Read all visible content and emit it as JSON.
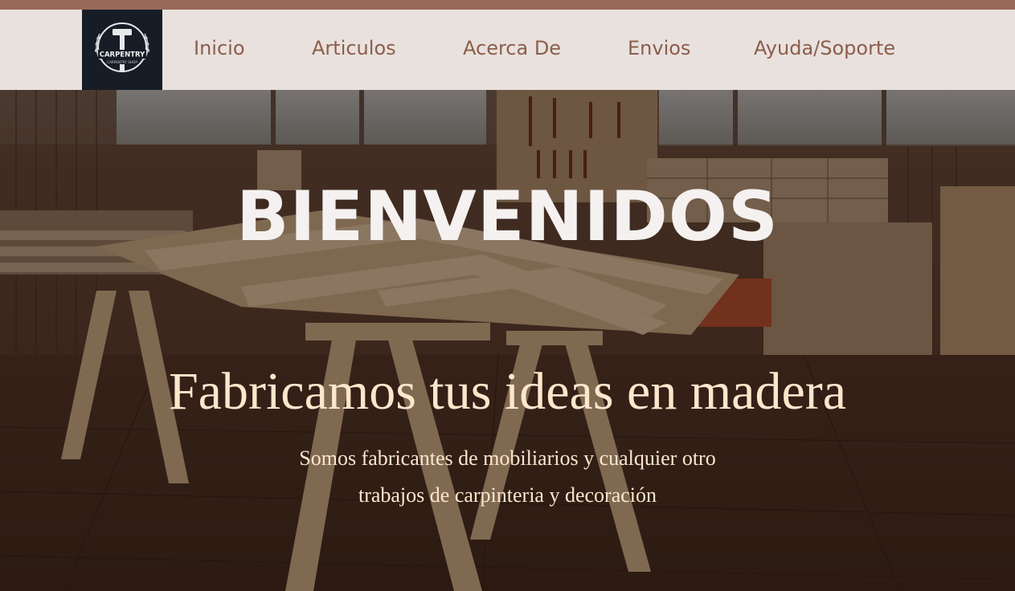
{
  "brand": {
    "logo_text": "CARPENTRY",
    "logo_subtext": "CARPENTRY SHOP"
  },
  "nav": {
    "items": [
      {
        "label": "Inicio"
      },
      {
        "label": "Articulos"
      },
      {
        "label": "Acerca De"
      },
      {
        "label": "Envios"
      },
      {
        "label": "Ayuda/Soporte"
      }
    ]
  },
  "hero": {
    "title": "BIENVENIDOS",
    "subtitle": "Fabricamos tus ideas en madera",
    "description_line1": "Somos fabricantes de mobiliarios y cualquier otro",
    "description_line2": "trabajos de carpinteria y decoración"
  },
  "colors": {
    "top_strip": "#98695a",
    "navbar_bg": "#e9e1de",
    "nav_text": "#8b5e4b",
    "logo_bg": "#171d26",
    "hero_title": "#f4f1f0",
    "hero_text": "#fde6cc"
  },
  "icons": {
    "logo": "hammer-icon"
  }
}
